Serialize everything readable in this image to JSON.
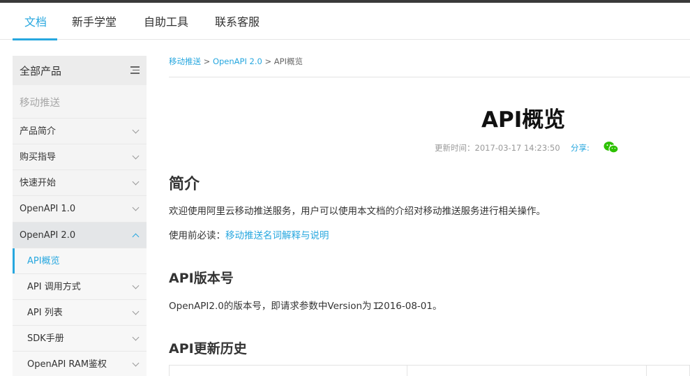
{
  "topnav": {
    "tabs": [
      {
        "label": "文档",
        "active": true
      },
      {
        "label": "新手学堂",
        "active": false
      },
      {
        "label": "自助工具",
        "active": false
      },
      {
        "label": "联系客服",
        "active": false
      }
    ]
  },
  "sidebar": {
    "header": "全部产品",
    "product": "移动推送",
    "items": [
      {
        "label": "产品简介"
      },
      {
        "label": "购买指导"
      },
      {
        "label": "快速开始"
      },
      {
        "label": "OpenAPI 1.0"
      },
      {
        "label": "OpenAPI 2.0"
      },
      {
        "label": "API概览"
      },
      {
        "label": "API 调用方式"
      },
      {
        "label": "API 列表"
      },
      {
        "label": "SDK手册"
      },
      {
        "label": "OpenAPI RAM鉴权"
      }
    ]
  },
  "breadcrumb": {
    "items": [
      "移动推送",
      "OpenAPI 2.0",
      "API概览"
    ],
    "separator": ">"
  },
  "article": {
    "title": "API概览",
    "updated_label": "更新时间：",
    "updated_value": "2017-03-17 14:23:50",
    "share_label": "分享:",
    "sections": {
      "intro_heading": "简介",
      "intro_text": "欢迎使用阿里云移动推送服务，用户可以使用本文档的介绍对移动推送服务进行相关操作。",
      "prereq_label": "使用前必读：",
      "prereq_link": "移动推送名词解释与说明",
      "version_heading": "API版本号",
      "version_text_before": "OpenAPI2.0的版本号，即请求参数中Version为",
      "version_value": "2016-08-01。",
      "history_heading": "API更新历史"
    }
  },
  "colors": {
    "accent": "#27a7df",
    "sidebar_bg": "#f4f4f4",
    "wechat_green": "#2dc100"
  }
}
